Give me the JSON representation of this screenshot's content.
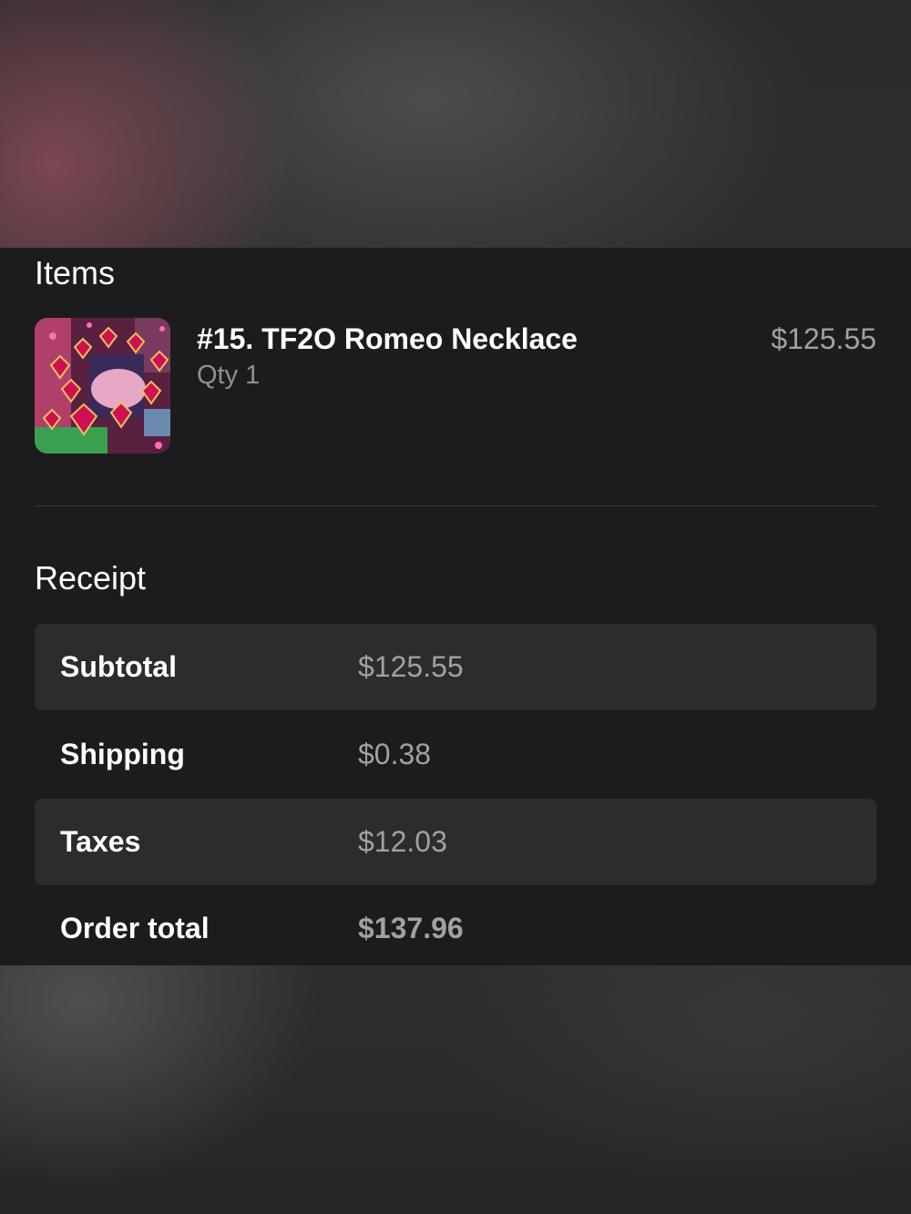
{
  "items_section": {
    "title": "Items",
    "items": [
      {
        "name": "#15. TF2O Romeo Necklace",
        "qty": "Qty 1",
        "price": "$125.55",
        "image": "necklace-product-thumbnail"
      }
    ]
  },
  "receipt_section": {
    "title": "Receipt",
    "rows": [
      {
        "label": "Subtotal",
        "value": "$125.55"
      },
      {
        "label": "Shipping",
        "value": "$0.38"
      },
      {
        "label": "Taxes",
        "value": "$12.03"
      },
      {
        "label": "Order total",
        "value": "$137.96"
      }
    ]
  },
  "colors": {
    "sheet_background": "#1c1c1e",
    "row_shade": "#2c2c2e",
    "primary_text": "#ffffff",
    "secondary_text": "#a0a0a5"
  }
}
